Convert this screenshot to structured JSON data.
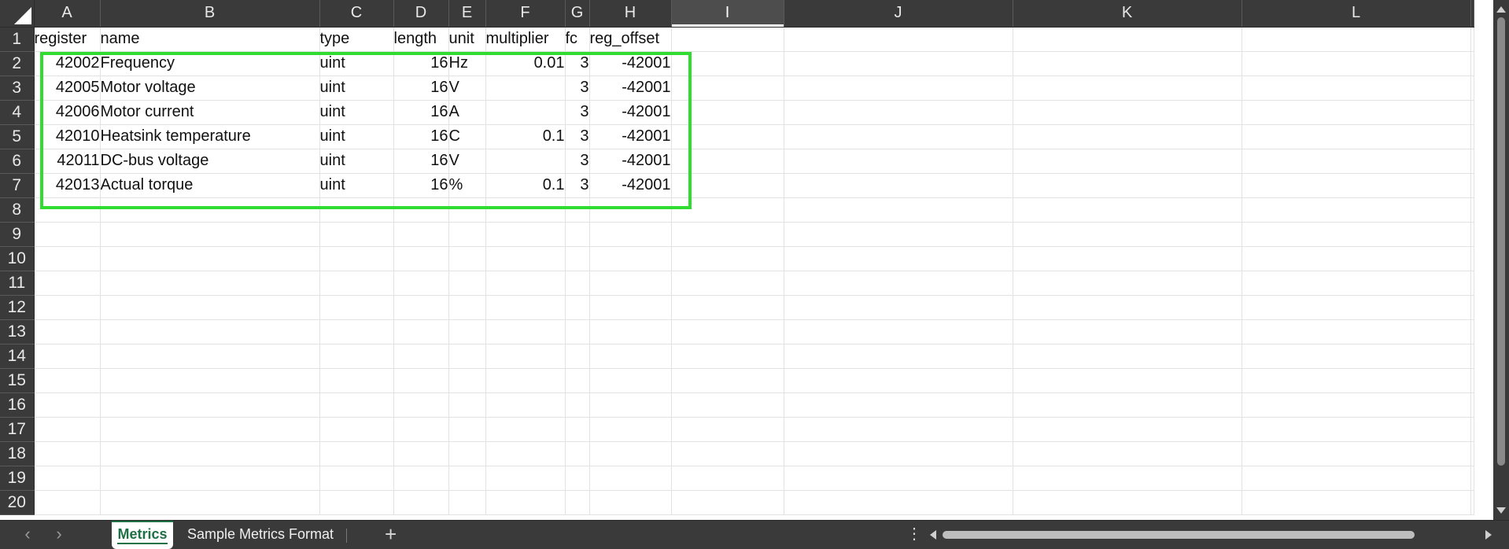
{
  "sheet": {
    "columns": [
      "A",
      "B",
      "C",
      "D",
      "E",
      "F",
      "G",
      "H",
      "I",
      "J",
      "K",
      "L"
    ],
    "selected_column": "I",
    "rows": [
      {
        "n": "1",
        "cells": [
          "register",
          "name",
          "type",
          "length",
          "unit",
          "multiplier",
          "fc",
          "reg_offset",
          "",
          "",
          "",
          ""
        ]
      },
      {
        "n": "2",
        "cells": [
          "42002",
          "Frequency",
          "uint",
          "16",
          "Hz",
          "0.01",
          "3",
          "-42001",
          "",
          "",
          "",
          ""
        ]
      },
      {
        "n": "3",
        "cells": [
          "42005",
          "Motor voltage",
          "uint",
          "16",
          "V",
          "",
          "3",
          "-42001",
          "",
          "",
          "",
          ""
        ]
      },
      {
        "n": "4",
        "cells": [
          "42006",
          "Motor current",
          "uint",
          "16",
          "A",
          "",
          "3",
          "-42001",
          "",
          "",
          "",
          ""
        ]
      },
      {
        "n": "5",
        "cells": [
          "42010",
          "Heatsink temperature",
          "uint",
          "16",
          "C",
          "0.1",
          "3",
          "-42001",
          "",
          "",
          "",
          ""
        ]
      },
      {
        "n": "6",
        "cells": [
          "42011",
          "DC-bus voltage",
          "uint",
          "16",
          "V",
          "",
          "3",
          "-42001",
          "",
          "",
          "",
          ""
        ]
      },
      {
        "n": "7",
        "cells": [
          "42013",
          "Actual torque",
          "uint",
          "16",
          "%",
          "0.1",
          "3",
          "-42001",
          "",
          "",
          "",
          ""
        ]
      },
      {
        "n": "8",
        "cells": [
          "",
          "",
          "",
          "",
          "",
          "",
          "",
          "",
          "",
          "",
          "",
          ""
        ]
      },
      {
        "n": "9",
        "cells": [
          "",
          "",
          "",
          "",
          "",
          "",
          "",
          "",
          "",
          "",
          "",
          ""
        ]
      },
      {
        "n": "10",
        "cells": [
          "",
          "",
          "",
          "",
          "",
          "",
          "",
          "",
          "",
          "",
          "",
          ""
        ]
      },
      {
        "n": "11",
        "cells": [
          "",
          "",
          "",
          "",
          "",
          "",
          "",
          "",
          "",
          "",
          "",
          ""
        ]
      },
      {
        "n": "12",
        "cells": [
          "",
          "",
          "",
          "",
          "",
          "",
          "",
          "",
          "",
          "",
          "",
          ""
        ]
      },
      {
        "n": "13",
        "cells": [
          "",
          "",
          "",
          "",
          "",
          "",
          "",
          "",
          "",
          "",
          "",
          ""
        ]
      },
      {
        "n": "14",
        "cells": [
          "",
          "",
          "",
          "",
          "",
          "",
          "",
          "",
          "",
          "",
          "",
          ""
        ]
      },
      {
        "n": "15",
        "cells": [
          "",
          "",
          "",
          "",
          "",
          "",
          "",
          "",
          "",
          "",
          "",
          ""
        ]
      },
      {
        "n": "16",
        "cells": [
          "",
          "",
          "",
          "",
          "",
          "",
          "",
          "",
          "",
          "",
          "",
          ""
        ]
      },
      {
        "n": "17",
        "cells": [
          "",
          "",
          "",
          "",
          "",
          "",
          "",
          "",
          "",
          "",
          "",
          ""
        ]
      },
      {
        "n": "18",
        "cells": [
          "",
          "",
          "",
          "",
          "",
          "",
          "",
          "",
          "",
          "",
          "",
          ""
        ]
      },
      {
        "n": "19",
        "cells": [
          "",
          "",
          "",
          "",
          "",
          "",
          "",
          "",
          "",
          "",
          "",
          ""
        ]
      },
      {
        "n": "20",
        "cells": [
          "",
          "",
          "",
          "",
          "",
          "",
          "",
          "",
          "",
          "",
          "",
          ""
        ]
      }
    ],
    "highlight_color": "#2fdc2f"
  },
  "tabs": {
    "prev_icon": "chevron-left-icon",
    "next_icon": "chevron-right-icon",
    "items": [
      {
        "label": "Metrics",
        "active": true
      },
      {
        "label": "Sample Metrics Format",
        "active": false
      }
    ],
    "add_icon": "+",
    "more_icon": "⋮"
  },
  "colors": {
    "header_bg": "#3a3a3a",
    "accent": "#1e7145"
  }
}
